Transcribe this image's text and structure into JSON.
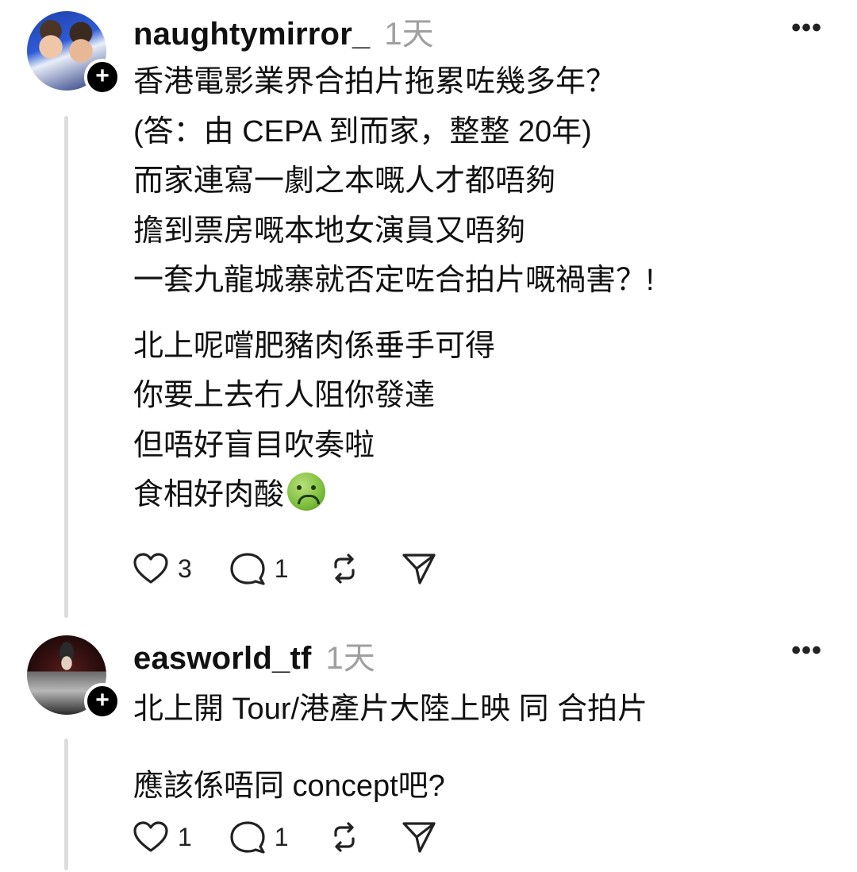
{
  "posts": [
    {
      "username": "naughtymirror_",
      "timestamp": "1天",
      "more_label": "•••",
      "lines": [
        "香港電影業界合拍片拖累咗幾多年？",
        "(答：由 CEPA 到而家，整整 20年)",
        "而家連寫一劇之本嘅人才都唔夠",
        "擔到票房嘅本地女演員又唔夠",
        "一套九龍城寨就否定咗合拍片嘅禍害？!",
        "北上呢嚐肥豬肉係垂手可得",
        "你要上去冇人阻你發達",
        "但唔好盲目吹奏啦",
        "食相好肉酸"
      ],
      "emoji": "nauseated-face",
      "likes": "3",
      "replies": "1"
    },
    {
      "username": "easworld_tf",
      "timestamp": "1天",
      "more_label": "•••",
      "lines": [
        "北上開 Tour/港產片大陸上映 同 合拍片",
        "應該係唔同 concept吧?"
      ],
      "likes": "1",
      "replies": "1"
    }
  ],
  "icons": {
    "like": "heart-icon",
    "reply": "comment-icon",
    "repost": "repost-icon",
    "share": "send-icon",
    "follow": "plus-icon"
  },
  "colors": {
    "text": "#111111",
    "muted": "#a0a0a0",
    "thread_line": "#dcdcdc",
    "emoji": "#7dbe3c"
  }
}
